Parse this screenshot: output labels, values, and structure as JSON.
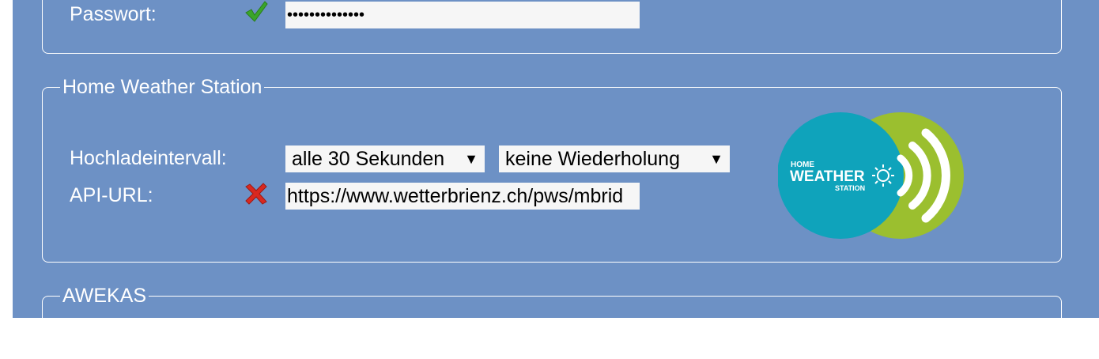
{
  "credentials": {
    "password_label": "Passwort:",
    "password_value": "••••••••••••••",
    "password_status_icon": "check-icon"
  },
  "hws": {
    "legend": "Home Weather Station",
    "interval_label": "Hochladeintervall:",
    "interval_selected": "alle 30 Sekunden",
    "repeat_selected": "keine Wiederholung",
    "api_label": "API-URL:",
    "api_value": "https://www.wetterbrienz.ch/pws/mbrid",
    "api_status_icon": "error-x-icon",
    "logo": {
      "line1": "HOME",
      "line2": "WEATHER",
      "line3": "STATION",
      "colors": {
        "teal": "#0fa3bb",
        "green": "#9bbf2f"
      }
    }
  },
  "awekas": {
    "legend": "AWEKAS"
  },
  "colors": {
    "panel_bg": "#6d91c5",
    "check": "#3aa52a",
    "error": "#d9281f"
  }
}
